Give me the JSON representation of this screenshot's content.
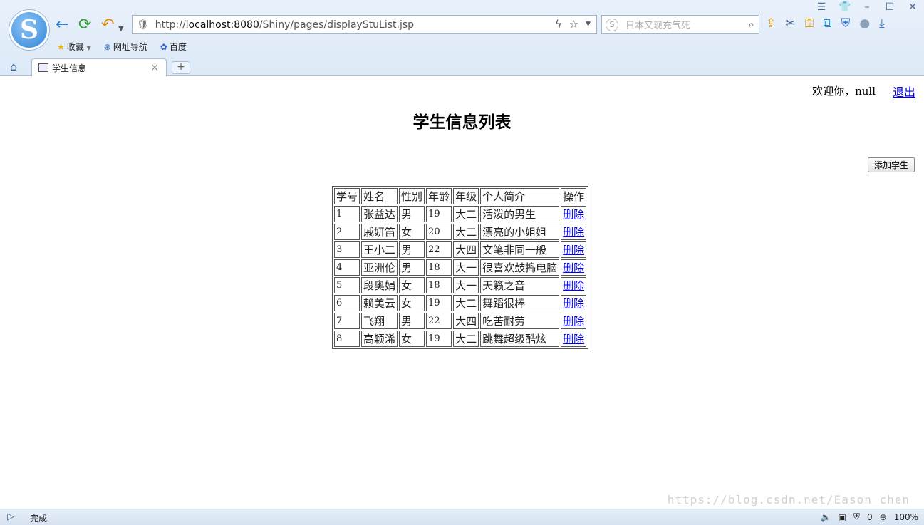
{
  "browser": {
    "url_prefix": "http://",
    "url_host": "localhost:8080",
    "url_path": "/Shiny/pages/displayStuList.jsp",
    "search_placeholder": "日本又现充气死",
    "bookmarks": [
      {
        "icon": "star-icon",
        "label": "收藏"
      },
      {
        "icon": "globe-icon",
        "label": "网址导航"
      },
      {
        "icon": "paw-icon",
        "label": "百度"
      }
    ],
    "tab_title": "学生信息",
    "status_text": "完成",
    "mute_label": "0",
    "zoom": "100%"
  },
  "header": {
    "welcome": "欢迎你，null",
    "logout": "退出",
    "title": "学生信息列表",
    "add_button": "添加学生"
  },
  "table": {
    "columns": [
      "学号",
      "姓名",
      "性别",
      "年龄",
      "年级",
      "个人简介",
      "操作"
    ],
    "delete_label": "删除",
    "rows": [
      [
        "1",
        "张益达",
        "男",
        "19",
        "大二",
        "活泼的男生"
      ],
      [
        "2",
        "戚妍笛",
        "女",
        "20",
        "大二",
        "漂亮的小姐姐"
      ],
      [
        "3",
        "王小二",
        "男",
        "22",
        "大四",
        "文笔非同一般"
      ],
      [
        "4",
        "亚洲伦",
        "男",
        "18",
        "大一",
        "很喜欢鼓捣电脑"
      ],
      [
        "5",
        "段奥娟",
        "女",
        "18",
        "大一",
        "天籁之音"
      ],
      [
        "6",
        "赖美云",
        "女",
        "19",
        "大二",
        "舞蹈很棒"
      ],
      [
        "7",
        "飞翔",
        "男",
        "22",
        "大四",
        "吃苦耐劳"
      ],
      [
        "8",
        "高颖浠",
        "女",
        "19",
        "大二",
        "跳舞超级酷炫"
      ]
    ]
  },
  "watermark": "https://blog.csdn.net/Eason_chen"
}
